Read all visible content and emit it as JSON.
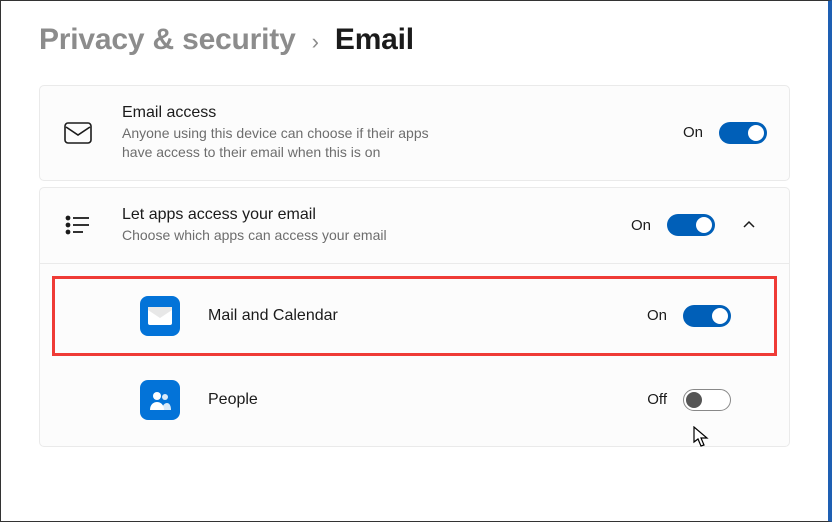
{
  "breadcrumb": {
    "parent": "Privacy & security",
    "current": "Email"
  },
  "sections": {
    "emailAccess": {
      "title": "Email access",
      "description": "Anyone using this device can choose if their apps have access to their email when this is on",
      "stateLabel": "On",
      "state": true
    },
    "letApps": {
      "title": "Let apps access your email",
      "description": "Choose which apps can access your email",
      "stateLabel": "On",
      "state": true,
      "expanded": true
    }
  },
  "apps": [
    {
      "name": "Mail and Calendar",
      "stateLabel": "On",
      "state": true,
      "highlighted": true
    },
    {
      "name": "People",
      "stateLabel": "Off",
      "state": false,
      "highlighted": false
    }
  ]
}
